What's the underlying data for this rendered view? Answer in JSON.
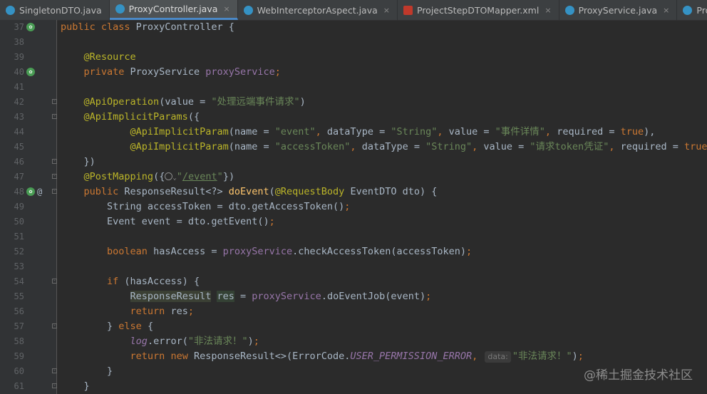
{
  "tabs": [
    {
      "label": "SingletonDTO.java",
      "icon": "java-class-icon",
      "active": false,
      "closable": false
    },
    {
      "label": "ProxyController.java",
      "icon": "java-class-icon",
      "active": true,
      "closable": true
    },
    {
      "label": "WebInterceptorAspect.java",
      "icon": "java-class-icon",
      "active": false,
      "closable": true
    },
    {
      "label": "ProjectStepDTOMapper.xml",
      "icon": "xml-file-icon",
      "active": false,
      "closable": true
    },
    {
      "label": "ProxyService.java",
      "icon": "java-class-icon",
      "active": false,
      "closable": true
    },
    {
      "label": "ProjectService.java",
      "icon": "java-class-icon",
      "active": false,
      "closable": false
    }
  ],
  "close_glyph": "×",
  "gutter_at": "@",
  "lines": [
    {
      "n": "37",
      "icon": "bean-icon",
      "fold": false,
      "code": [
        [
          "public class ",
          "kw"
        ],
        [
          "ProxyController {",
          ""
        ]
      ]
    },
    {
      "n": "38",
      "code": []
    },
    {
      "n": "39",
      "code": [
        [
          "    ",
          ""
        ],
        [
          "@Resource",
          "an"
        ]
      ]
    },
    {
      "n": "40",
      "icon": "bean-icon",
      "code": [
        [
          "    ",
          ""
        ],
        [
          "private ",
          "kw"
        ],
        [
          "ProxyService ",
          ""
        ],
        [
          "proxyService",
          "fld"
        ],
        [
          ";",
          "kw"
        ]
      ]
    },
    {
      "n": "41",
      "code": []
    },
    {
      "n": "42",
      "fold": true,
      "code": [
        [
          "    ",
          ""
        ],
        [
          "@ApiOperation",
          "an"
        ],
        [
          "(value = ",
          ""
        ],
        [
          "\"处理远端事件请求\"",
          "str"
        ],
        [
          ")",
          ""
        ]
      ]
    },
    {
      "n": "43",
      "fold": true,
      "code": [
        [
          "    ",
          ""
        ],
        [
          "@ApiImplicitParams",
          "an"
        ],
        [
          "({",
          ""
        ]
      ]
    },
    {
      "n": "44",
      "code": [
        [
          "            ",
          ""
        ],
        [
          "@ApiImplicitParam",
          "an"
        ],
        [
          "(name = ",
          ""
        ],
        [
          "\"event\"",
          "str"
        ],
        [
          ", ",
          "kw"
        ],
        [
          "dataType = ",
          ""
        ],
        [
          "\"String\"",
          "str"
        ],
        [
          ", ",
          "kw"
        ],
        [
          "value = ",
          ""
        ],
        [
          "\"事件详情\"",
          "str"
        ],
        [
          ", ",
          "kw"
        ],
        [
          "required = ",
          ""
        ],
        [
          "true",
          "kw"
        ],
        [
          "),",
          ""
        ]
      ]
    },
    {
      "n": "45",
      "code": [
        [
          "            ",
          ""
        ],
        [
          "@ApiImplicitParam",
          "an"
        ],
        [
          "(name = ",
          ""
        ],
        [
          "\"accessToken\"",
          "str"
        ],
        [
          ", ",
          "kw"
        ],
        [
          "dataType = ",
          ""
        ],
        [
          "\"String\"",
          "str"
        ],
        [
          ", ",
          "kw"
        ],
        [
          "value = ",
          ""
        ],
        [
          "\"请求token凭证\"",
          "str"
        ],
        [
          ", ",
          "kw"
        ],
        [
          "required = ",
          ""
        ],
        [
          "true",
          "kw"
        ],
        [
          ")",
          ""
        ]
      ]
    },
    {
      "n": "46",
      "fold": true,
      "code": [
        [
          "    ",
          ""
        ],
        [
          "})",
          ""
        ]
      ]
    },
    {
      "n": "47",
      "fold": true,
      "code": [
        [
          "    ",
          ""
        ],
        [
          "@PostMapping",
          "an"
        ],
        [
          "({",
          ""
        ],
        [
          "@globe",
          ""
        ],
        [
          "\"",
          "str"
        ],
        [
          "/event",
          "str url"
        ],
        [
          "\"",
          "str"
        ],
        [
          "})",
          ""
        ]
      ]
    },
    {
      "n": "48",
      "icon": "bean-icon",
      "at": true,
      "fold": true,
      "code": [
        [
          "    ",
          ""
        ],
        [
          "public ",
          "kw"
        ],
        [
          "ResponseResult<?> ",
          ""
        ],
        [
          "doEvent",
          "fn"
        ],
        [
          "(",
          ""
        ],
        [
          "@RequestBody ",
          "an"
        ],
        [
          "EventDTO dto) {",
          ""
        ]
      ]
    },
    {
      "n": "49",
      "code": [
        [
          "        ",
          ""
        ],
        [
          "String accessToken = dto.getAccessToken()",
          ""
        ],
        [
          ";",
          "kw"
        ]
      ]
    },
    {
      "n": "50",
      "code": [
        [
          "        ",
          ""
        ],
        [
          "Event event = dto.getEvent()",
          ""
        ],
        [
          ";",
          "kw"
        ]
      ]
    },
    {
      "n": "51",
      "code": []
    },
    {
      "n": "52",
      "code": [
        [
          "        ",
          ""
        ],
        [
          "boolean ",
          "kw"
        ],
        [
          "hasAccess = ",
          ""
        ],
        [
          "proxyService",
          "fld"
        ],
        [
          ".checkAccessToken(accessToken)",
          ""
        ],
        [
          ";",
          "kw"
        ]
      ]
    },
    {
      "n": "53",
      "code": []
    },
    {
      "n": "54",
      "fold": true,
      "code": [
        [
          "        ",
          ""
        ],
        [
          "if ",
          "kw"
        ],
        [
          "(hasAccess) {",
          ""
        ]
      ]
    },
    {
      "n": "55",
      "code": [
        [
          "            ",
          ""
        ],
        [
          "ResponseResult",
          "hl"
        ],
        [
          " ",
          ""
        ],
        [
          "res",
          "hl2"
        ],
        [
          " = ",
          ""
        ],
        [
          "proxyService",
          "fld"
        ],
        [
          ".doEventJob(event)",
          ""
        ],
        [
          ";",
          "kw"
        ]
      ]
    },
    {
      "n": "56",
      "code": [
        [
          "            ",
          ""
        ],
        [
          "return ",
          "kw"
        ],
        [
          "res",
          ""
        ],
        [
          ";",
          "kw"
        ]
      ]
    },
    {
      "n": "57",
      "fold": true,
      "code": [
        [
          "        ",
          ""
        ],
        [
          "} ",
          ""
        ],
        [
          "else ",
          "kw"
        ],
        [
          "{",
          ""
        ]
      ]
    },
    {
      "n": "58",
      "code": [
        [
          "            ",
          ""
        ],
        [
          "log",
          "it"
        ],
        [
          ".error(",
          ""
        ],
        [
          "\"非法请求！\"",
          "str"
        ],
        [
          ")",
          ""
        ],
        [
          ";",
          "kw"
        ]
      ]
    },
    {
      "n": "59",
      "code": [
        [
          "            ",
          ""
        ],
        [
          "return new ",
          "kw"
        ],
        [
          "ResponseResult<>(ErrorCode.",
          ""
        ],
        [
          "USER_PERMISSION_ERROR",
          "cst"
        ],
        [
          ", ",
          "kw"
        ],
        [
          "@hint:data:",
          ""
        ],
        [
          "\"非法请求！\"",
          "str"
        ],
        [
          ")",
          ""
        ],
        [
          ";",
          "kw"
        ]
      ]
    },
    {
      "n": "60",
      "fold": true,
      "code": [
        [
          "        ",
          ""
        ],
        [
          "}",
          ""
        ]
      ]
    },
    {
      "n": "61",
      "fold": true,
      "code": [
        [
          "    ",
          ""
        ],
        [
          "}",
          ""
        ]
      ]
    }
  ],
  "watermark": "@稀土掘金技术社区"
}
